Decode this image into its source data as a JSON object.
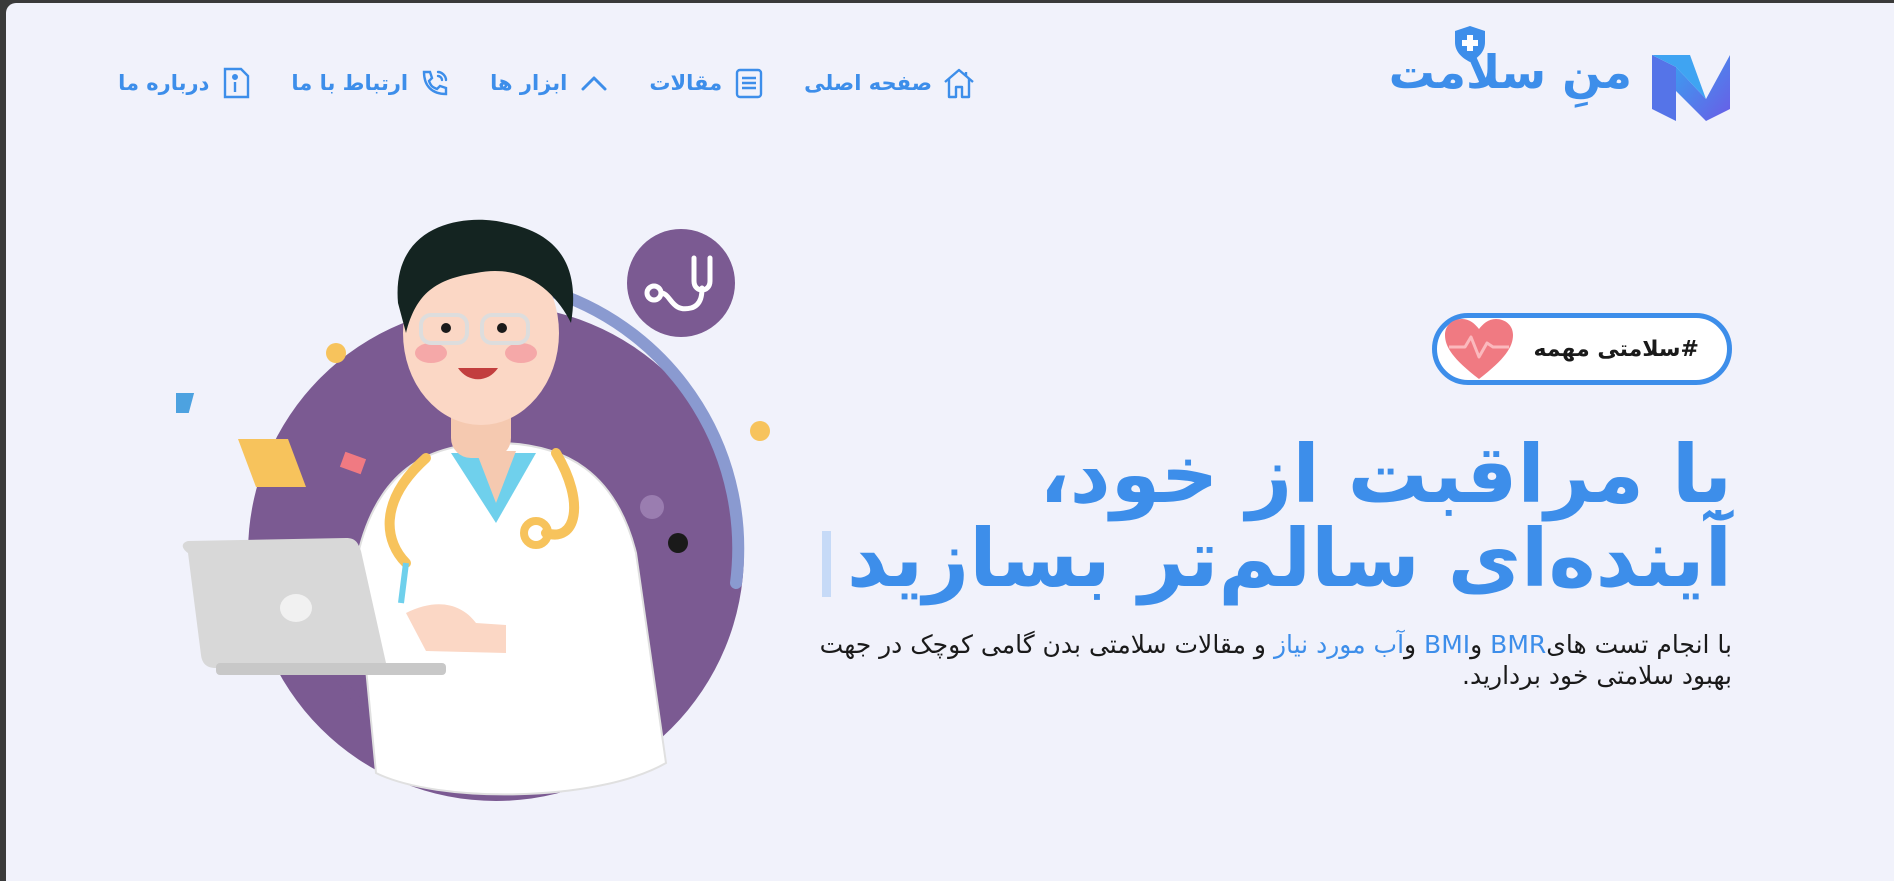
{
  "brand": {
    "name": "منِ سلامت",
    "color": "#3d8eea"
  },
  "nav": {
    "items": [
      {
        "label": "صفحه اصلی",
        "icon": "home-icon"
      },
      {
        "label": "مقالات",
        "icon": "document-icon"
      },
      {
        "label": "ابزار ها",
        "icon": "chevron-up-icon"
      },
      {
        "label": "ارتباط با ما",
        "icon": "phone-icon"
      },
      {
        "label": "درباره ما",
        "icon": "info-icon"
      }
    ]
  },
  "hero": {
    "badge": "#سلامتی مهمه",
    "headline_line1": "با مراقبت از خود،",
    "headline_line2": "آینده‌ای سالم‌تر بسازید",
    "desc": {
      "part1": "با انجام تست های",
      "bmr": "BMR",
      "and1": " و",
      "bmi": "BMI",
      "and2": " و",
      "water": "آب مورد نیاز",
      "part2": " و مقالات سلامتی بدن گامی کوچک در جهت بهبود سلامتی خود بردارید."
    }
  },
  "colors": {
    "background": "#f1f2fb",
    "accent": "#3d8eea",
    "purple": "#7b5a92",
    "heart": "#f0707a"
  }
}
